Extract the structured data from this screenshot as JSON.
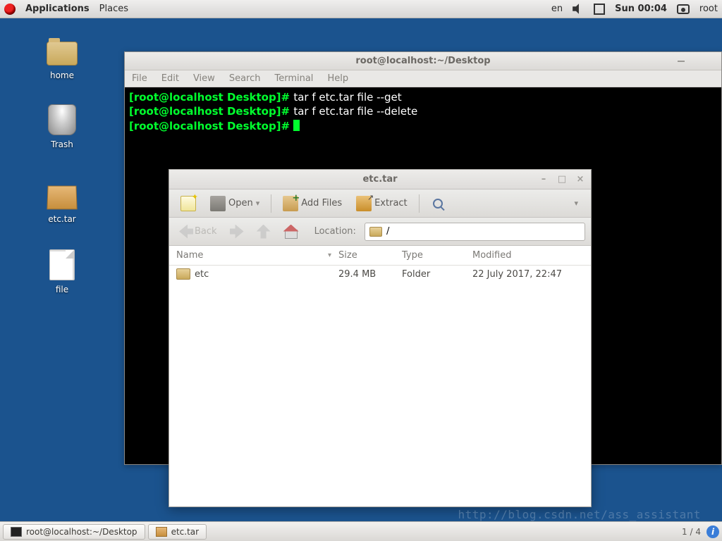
{
  "panel": {
    "applications": "Applications",
    "places": "Places",
    "lang": "en",
    "clock": "Sun 00:04",
    "user": "root"
  },
  "desktop": {
    "home": "home",
    "trash": "Trash",
    "etctar": "etc.tar",
    "file": "file"
  },
  "terminal": {
    "title": "root@localhost:~/Desktop",
    "menus": {
      "file": "File",
      "edit": "Edit",
      "view": "View",
      "search": "Search",
      "terminal": "Terminal",
      "help": "Help"
    },
    "prompt": "[root@localhost Desktop]# ",
    "cmd1": "tar f etc.tar file --get",
    "cmd2": "tar f etc.tar file --delete"
  },
  "archive": {
    "title": "etc.tar",
    "toolbar": {
      "open": "Open",
      "add": "Add Files",
      "extract": "Extract"
    },
    "nav": {
      "back": "Back",
      "location_label": "Location:",
      "location_value": "/"
    },
    "columns": {
      "name": "Name",
      "size": "Size",
      "type": "Type",
      "modified": "Modified"
    },
    "rows": [
      {
        "name": "etc",
        "size": "29.4 MB",
        "type": "Folder",
        "modified": "22 July 2017, 22:47"
      }
    ]
  },
  "taskbar": {
    "task1": "root@localhost:~/Desktop",
    "task2": "etc.tar",
    "workspace": "1 / 4"
  },
  "watermark": "http://blog.csdn.net/ass_assistant"
}
